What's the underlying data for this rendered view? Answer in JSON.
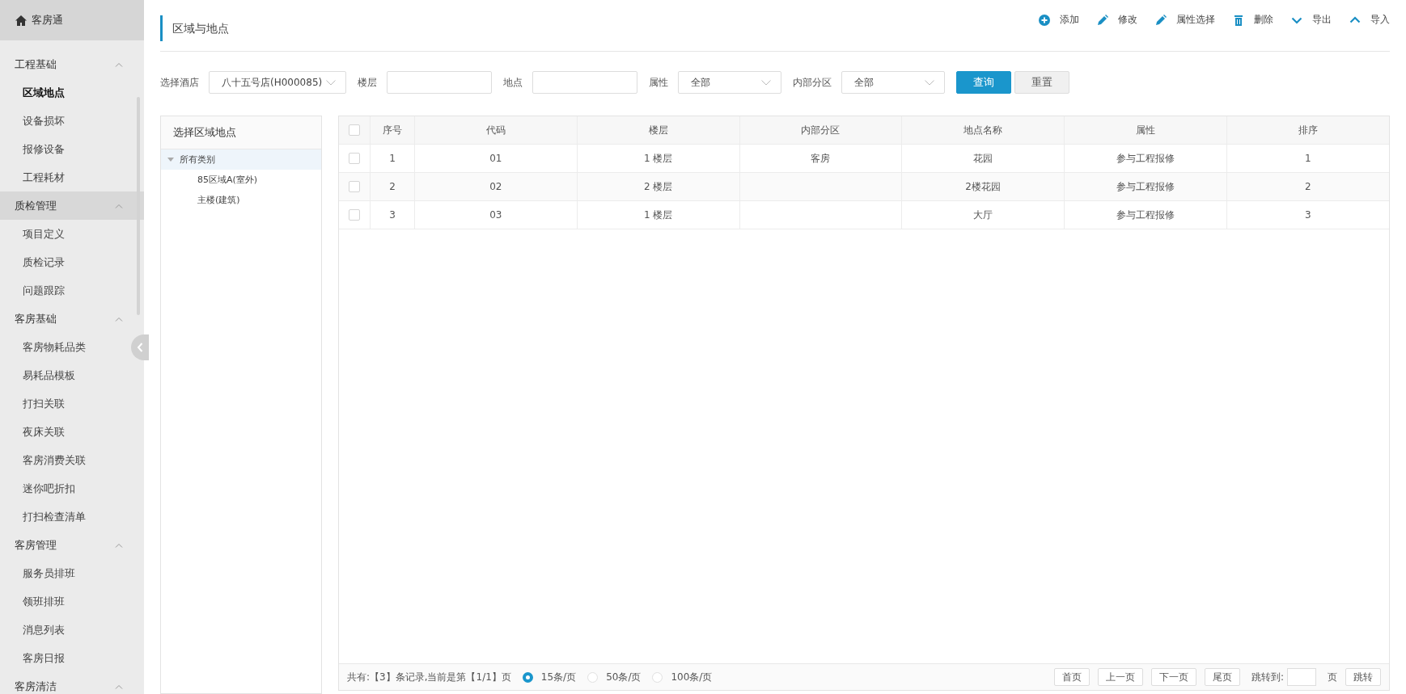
{
  "sidebar": {
    "brand": "客房通",
    "groups": [
      {
        "label": "工程基础",
        "expanded": true,
        "highlighted": false,
        "items": [
          {
            "label": "区域地点",
            "selected": true
          },
          {
            "label": "设备损坏",
            "selected": false
          },
          {
            "label": "报修设备",
            "selected": false
          },
          {
            "label": "工程耗材",
            "selected": false
          }
        ]
      },
      {
        "label": "质检管理",
        "expanded": true,
        "highlighted": true,
        "items": [
          {
            "label": "项目定义",
            "selected": false
          },
          {
            "label": "质检记录",
            "selected": false
          },
          {
            "label": "问题跟踪",
            "selected": false
          }
        ]
      },
      {
        "label": "客房基础",
        "expanded": true,
        "highlighted": false,
        "items": [
          {
            "label": "客房物耗品类",
            "selected": false
          },
          {
            "label": "易耗品模板",
            "selected": false
          },
          {
            "label": "打扫关联",
            "selected": false
          },
          {
            "label": "夜床关联",
            "selected": false
          },
          {
            "label": "客房消费关联",
            "selected": false
          },
          {
            "label": "迷你吧折扣",
            "selected": false
          },
          {
            "label": "打扫检查清单",
            "selected": false
          }
        ]
      },
      {
        "label": "客房管理",
        "expanded": true,
        "highlighted": false,
        "items": [
          {
            "label": "服务员排班",
            "selected": false
          },
          {
            "label": "领班排班",
            "selected": false
          },
          {
            "label": "消息列表",
            "selected": false
          },
          {
            "label": "客房日报",
            "selected": false
          }
        ]
      },
      {
        "label": "客房清洁",
        "expanded": true,
        "highlighted": false
      }
    ]
  },
  "page_title": "区域与地点",
  "actions": [
    {
      "kind": "add",
      "label": "添加"
    },
    {
      "kind": "edit",
      "label": "修改"
    },
    {
      "kind": "edit",
      "label": "属性选择"
    },
    {
      "kind": "delete",
      "label": "删除"
    },
    {
      "kind": "export",
      "label": "导出"
    },
    {
      "kind": "import",
      "label": "导入"
    }
  ],
  "filters": [
    {
      "label": "选择酒店",
      "kind": "select",
      "value": "八十五号店(H000085)"
    },
    {
      "label": "楼层",
      "kind": "input"
    },
    {
      "label": "地点",
      "kind": "input"
    },
    {
      "label": "属性",
      "kind": "select",
      "value": "全部"
    },
    {
      "label": "内部分区",
      "kind": "select",
      "value": "全部"
    }
  ],
  "buttons": [
    {
      "kind": "primary",
      "label": "查询"
    },
    {
      "kind": "default",
      "label": "重置"
    }
  ],
  "tree": {
    "title": "选择区域地点",
    "nodes": [
      {
        "label": "所有类别",
        "expanded": true,
        "selected": true,
        "children": [
          {
            "label": "85区域A(室外)",
            "selected": false
          },
          {
            "label": "主楼(建筑)",
            "selected": false
          }
        ]
      }
    ]
  },
  "table": {
    "all_checked": false,
    "columns": [
      "序号",
      "代码",
      "楼层",
      "内部分区",
      "地点名称",
      "属性",
      "排序"
    ],
    "rows": [
      {
        "checked": false,
        "cells": [
          "1",
          "01",
          "1 楼层",
          "客房",
          "花园",
          "参与工程报修",
          "1"
        ]
      },
      {
        "checked": false,
        "cells": [
          "2",
          "02",
          "2 楼层",
          "",
          "2楼花园",
          "参与工程报修",
          "2"
        ]
      },
      {
        "checked": false,
        "cells": [
          "3",
          "03",
          "1 楼层",
          "",
          "大厅",
          "参与工程报修",
          "3"
        ]
      }
    ]
  },
  "pagination": {
    "summary": "共有:【3】条记录,当前是第【1/1】页",
    "page_sizes": [
      {
        "label": "15条/页",
        "selected": true
      },
      {
        "label": "50条/页",
        "selected": false
      },
      {
        "label": "100条/页",
        "selected": false
      }
    ],
    "nav": [
      "首页",
      "上一页",
      "下一页",
      "尾页"
    ],
    "jump_label": "跳转到:",
    "page_unit": "页",
    "jump_button": "跳转"
  }
}
